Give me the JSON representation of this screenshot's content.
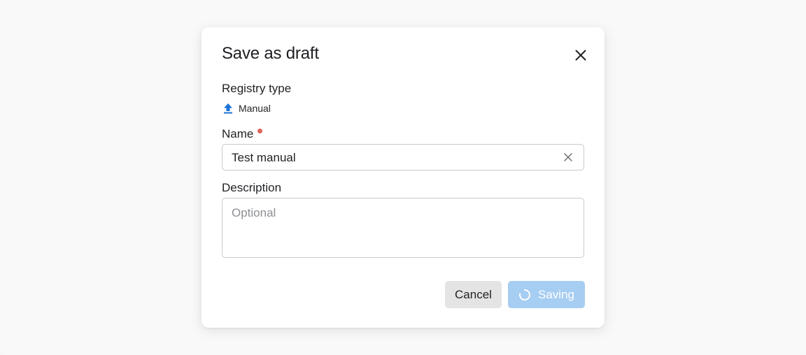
{
  "dialog": {
    "title": "Save as draft",
    "close_icon": "close-icon"
  },
  "registry": {
    "label": "Registry type",
    "icon": "upload-icon",
    "value": "Manual",
    "icon_color": "#1a73d9"
  },
  "name_field": {
    "label": "Name",
    "required": true,
    "value": "Test manual",
    "clear_icon": "clear-icon"
  },
  "description_field": {
    "label": "Description",
    "placeholder": "Optional",
    "value": ""
  },
  "actions": {
    "cancel_label": "Cancel",
    "saving_label": "Saving",
    "saving_icon": "spinner-icon",
    "saving_color": "#a6cdf2"
  }
}
